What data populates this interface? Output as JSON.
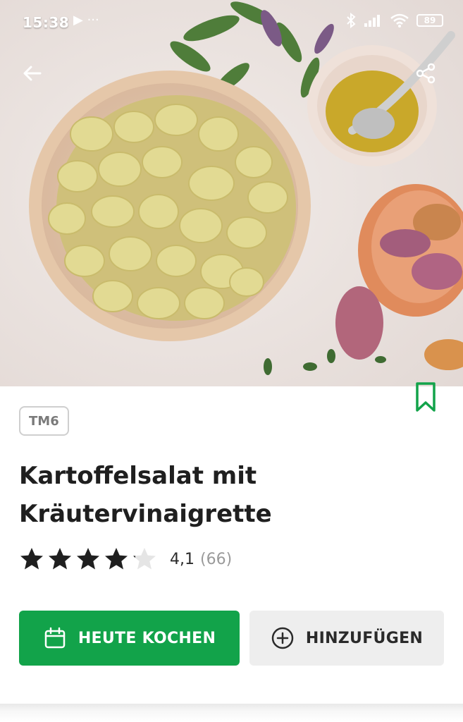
{
  "status_bar": {
    "time": "15:38",
    "left_icons": "▶ ···",
    "battery": "89"
  },
  "hero": {
    "image_alt": "Kartoffelsalat in einer Schüssel mit Senf und Schalotten",
    "back_icon": "arrow-left-icon",
    "share_icon": "share-icon"
  },
  "bookmark_icon": "bookmark-icon",
  "tag": "TM6",
  "recipe": {
    "title_line1": "Kartoffelsalat mit",
    "title_line2": "Kräutervinaigrette"
  },
  "rating": {
    "stars": 4.1,
    "max": 5,
    "value": "4,1",
    "count": "(66)"
  },
  "actions": {
    "cook_today": "HEUTE KOCHEN",
    "add": "HINZUFÜGEN"
  },
  "colors": {
    "accent": "#12a34a",
    "star": "#1f1f1f",
    "star_empty": "#e5e5e5"
  }
}
